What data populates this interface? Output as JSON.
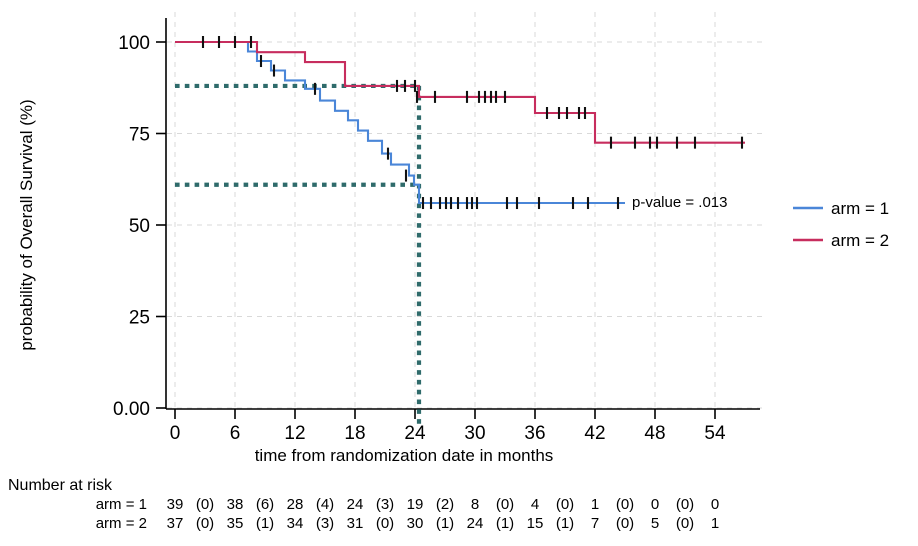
{
  "chart_data": {
    "type": "line",
    "title": "",
    "subtitle": "",
    "xlabel": "time from randomization date in months",
    "ylabel": "probability of Overall Survival (%)",
    "xlim": [
      0,
      58.5
    ],
    "ylim": [
      0,
      103
    ],
    "xticks": [
      0,
      6,
      12,
      18,
      24,
      30,
      36,
      42,
      48,
      54
    ],
    "xticklabels": [
      "0",
      "6",
      "12",
      "18",
      "24",
      "30",
      "36",
      "42",
      "48",
      "54"
    ],
    "yticks": [
      0,
      25,
      50,
      75,
      100
    ],
    "yticklabels": [
      "0.00",
      "25",
      "50",
      "75",
      "100"
    ],
    "grid": true,
    "legend_position": "right",
    "colors": {
      "arm1": "#4a86d8",
      "arm2": "#c72d5e",
      "reference_line": "#2f6b6b",
      "annotation": "#e8341c",
      "grid": "#d9d9d9",
      "axis": "#000000"
    },
    "series": [
      {
        "name": "arm = 1",
        "legend_label": "arm = 1",
        "color": "#4a86d8",
        "steps": [
          [
            0,
            100
          ],
          [
            7.3,
            100
          ],
          [
            7.3,
            97.4
          ],
          [
            8.2,
            97.4
          ],
          [
            8.2,
            94.8
          ],
          [
            9.6,
            94.8
          ],
          [
            9.6,
            92.2
          ],
          [
            11.0,
            92.2
          ],
          [
            11.0,
            89.5
          ],
          [
            13.0,
            89.5
          ],
          [
            13.0,
            87.2
          ],
          [
            14.5,
            87.2
          ],
          [
            14.5,
            84.0
          ],
          [
            16.0,
            84.0
          ],
          [
            16.0,
            81.2
          ],
          [
            17.3,
            81.2
          ],
          [
            17.3,
            78.6
          ],
          [
            18.3,
            78.6
          ],
          [
            18.3,
            75.8
          ],
          [
            19.3,
            75.8
          ],
          [
            19.3,
            73.0
          ],
          [
            20.7,
            73.0
          ],
          [
            20.7,
            69.5
          ],
          [
            21.6,
            69.5
          ],
          [
            21.6,
            66.5
          ],
          [
            23.4,
            66.5
          ],
          [
            23.4,
            63.5
          ],
          [
            23.9,
            63.5
          ],
          [
            23.9,
            61.0
          ],
          [
            24.4,
            61.0
          ],
          [
            24.4,
            56.0
          ],
          [
            45.0,
            56.0
          ]
        ],
        "censor_times": [
          8.6,
          9.9,
          14.0,
          21.3,
          23.1,
          24.8,
          25.6,
          26.5,
          27.1,
          27.6,
          28.3,
          29.2,
          29.7,
          30.2,
          33.2,
          34.2,
          36.4,
          39.8,
          41.3,
          44.3
        ],
        "censor_values": [
          94.8,
          92.2,
          87.2,
          69.5,
          63.5,
          56.0,
          56.0,
          56.0,
          56.0,
          56.0,
          56.0,
          56.0,
          56.0,
          56.0,
          56.0,
          56.0,
          56.0,
          56.0,
          56.0,
          56.0
        ]
      },
      {
        "name": "arm = 2",
        "legend_label": "arm = 2",
        "color": "#c72d5e",
        "steps": [
          [
            0,
            100
          ],
          [
            8.2,
            100
          ],
          [
            8.2,
            97.2
          ],
          [
            13.0,
            97.2
          ],
          [
            13.0,
            94.5
          ],
          [
            17.0,
            94.5
          ],
          [
            17.0,
            88.0
          ],
          [
            24.4,
            88.0
          ],
          [
            24.4,
            85.0
          ],
          [
            36.0,
            85.0
          ],
          [
            36.0,
            80.6
          ],
          [
            42.0,
            80.6
          ],
          [
            42.0,
            72.5
          ],
          [
            57.0,
            72.5
          ]
        ],
        "censor_times": [
          2.8,
          4.4,
          6.0,
          7.6,
          22.2,
          23.0,
          24.0,
          24.2,
          26.0,
          29.2,
          30.4,
          31.0,
          31.6,
          32.1,
          33.0,
          37.2,
          38.4,
          39.2,
          40.4,
          41.0,
          43.6,
          46.0,
          47.5,
          48.2,
          50.2,
          52.0,
          56.7
        ],
        "censor_values": [
          100,
          100,
          100,
          100,
          88.0,
          88.0,
          88.0,
          85.0,
          85.0,
          85.0,
          85.0,
          85.0,
          85.0,
          85.0,
          85.0,
          80.6,
          80.6,
          80.6,
          80.6,
          80.6,
          72.5,
          72.5,
          72.5,
          72.5,
          72.5,
          72.5,
          72.5
        ]
      }
    ],
    "reference_lines": [
      {
        "name": "arm2-24mo-survival",
        "orientation": "horizontal",
        "value": 88.0,
        "x_from": 0,
        "x_to": 24.4
      },
      {
        "name": "arm1-24mo-survival",
        "orientation": "horizontal",
        "value": 61.0,
        "x_from": 0,
        "x_to": 24.4
      },
      {
        "name": "landmark-24-months",
        "orientation": "vertical",
        "value": 24.4,
        "y_from": 0,
        "y_to": 88.0
      }
    ],
    "annotations": [
      {
        "name": "p-value-annotation",
        "text": "p-value = .013",
        "x": 47.0,
        "y": 56.0,
        "highlight": "ellipse",
        "highlight_color": "#e8341c"
      }
    ]
  },
  "risk_table": {
    "heading": "Number at risk",
    "rows": [
      {
        "label": "arm = 1",
        "values": [
          "39",
          "(0)",
          "38",
          "(6)",
          "28",
          "(4)",
          "24",
          "(3)",
          "19",
          "(2)",
          "8",
          "(0)",
          "4",
          "(0)",
          "1",
          "(0)",
          "0",
          "(0)",
          "0"
        ]
      },
      {
        "label": "arm = 2",
        "values": [
          "37",
          "(0)",
          "35",
          "(1)",
          "34",
          "(3)",
          "31",
          "(0)",
          "30",
          "(1)",
          "24",
          "(1)",
          "15",
          "(1)",
          "7",
          "(0)",
          "5",
          "(0)",
          "1"
        ]
      }
    ]
  },
  "legend": {
    "items": [
      {
        "label": "arm = 1",
        "color": "#4a86d8"
      },
      {
        "label": "arm = 2",
        "color": "#c72d5e"
      }
    ]
  }
}
